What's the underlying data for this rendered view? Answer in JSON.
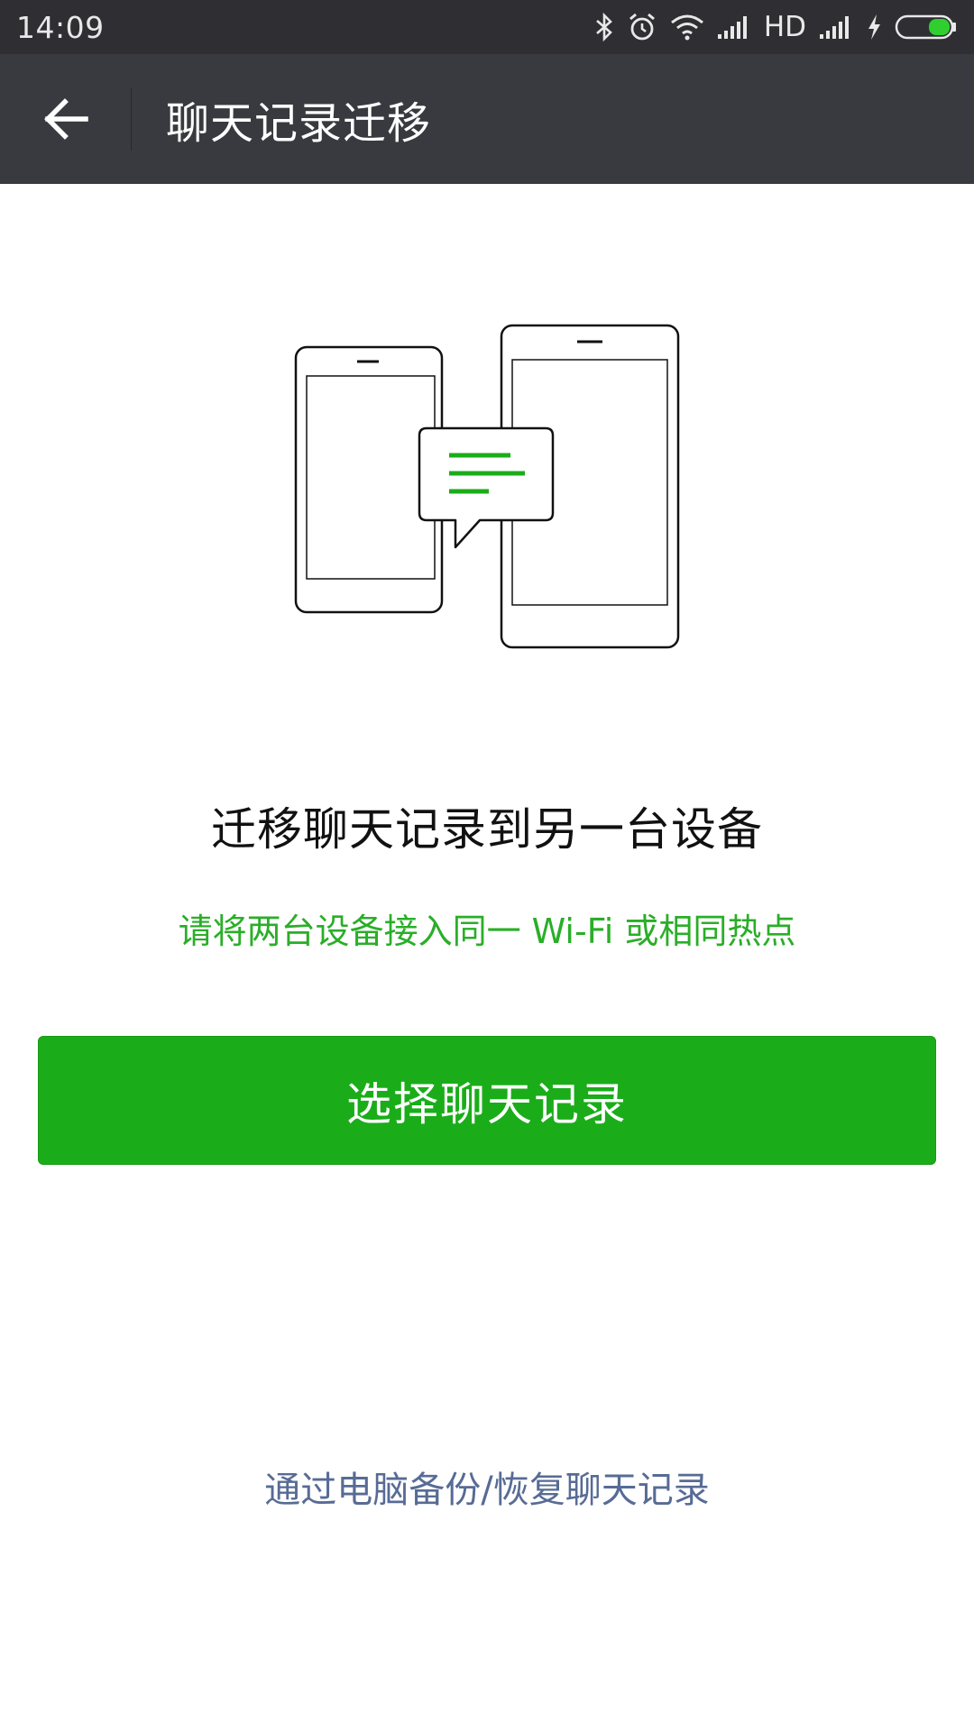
{
  "status_bar": {
    "time": "14:09",
    "network_label": "HD",
    "icons": [
      "bluetooth-icon",
      "alarm-icon",
      "wifi-icon",
      "signal-icon",
      "signal-icon",
      "charging-icon",
      "battery-icon"
    ]
  },
  "app_bar": {
    "title": "聊天记录迁移",
    "back_icon": "arrow-left-icon"
  },
  "main": {
    "illustration_icon": "phones-transfer-icon",
    "heading": "迁移聊天记录到另一台设备",
    "hint": "请将两台设备接入同一 Wi-Fi 或相同热点",
    "primary_button": "选择聊天记录",
    "pc_backup_link": "通过电脑备份/恢复聊天记录"
  },
  "colors": {
    "accent": "#1aad19",
    "link": "#576b95",
    "app_bar": "#393a3f",
    "status_bar": "#2e2e33"
  }
}
